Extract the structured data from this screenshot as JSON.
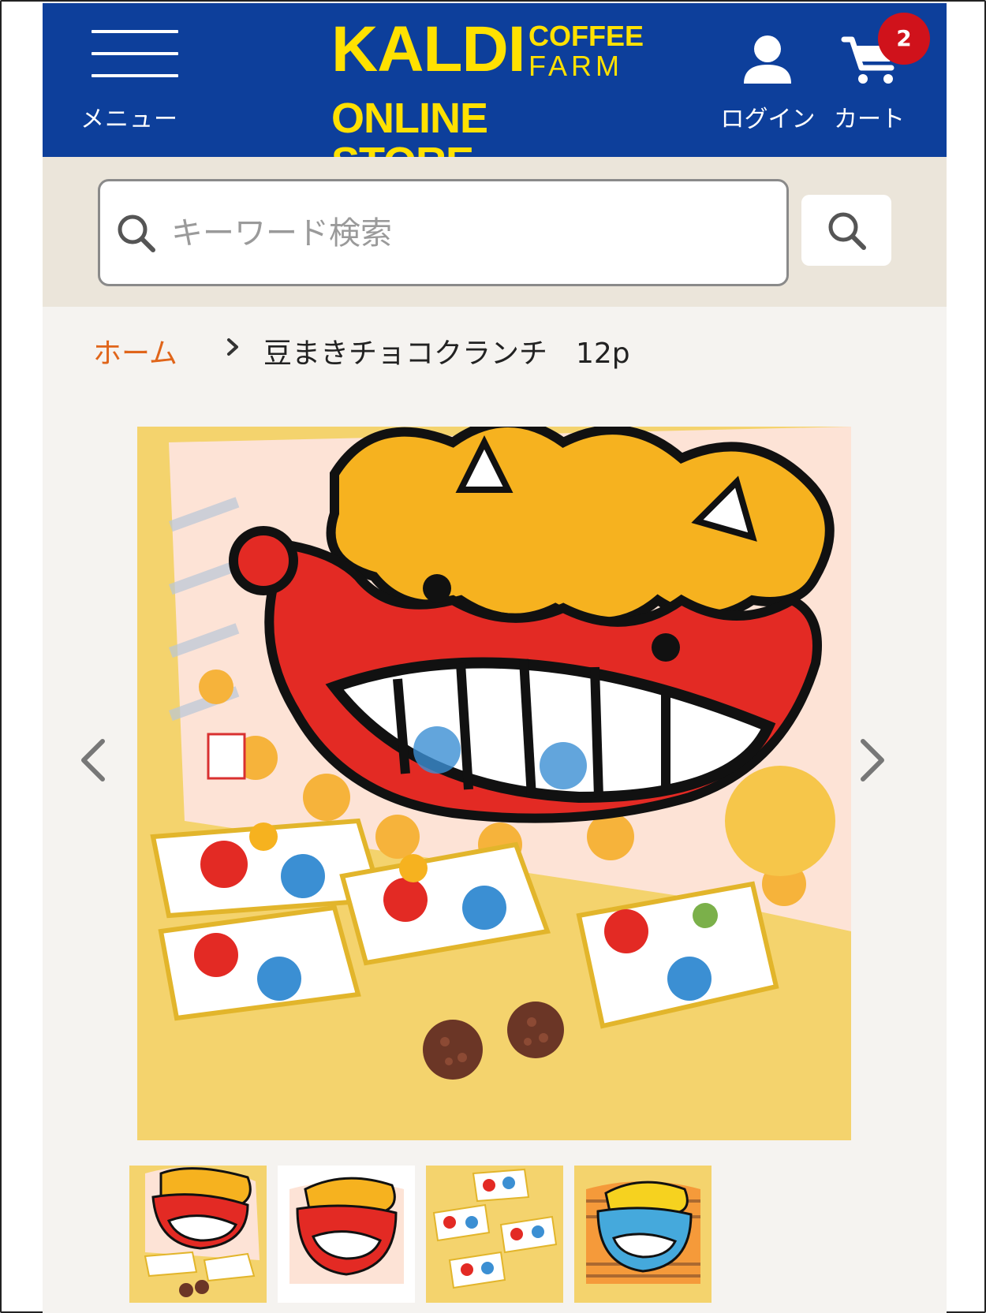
{
  "header": {
    "menu_label": "メニュー",
    "logo": {
      "kaldi": "KALDI",
      "coffee": "COFFEE",
      "farm": "FARM",
      "online_store": "ONLINE STORE"
    },
    "login_label": "ログイン",
    "cart_label": "カート",
    "cart_count": "2"
  },
  "search": {
    "placeholder": "キーワード検索",
    "value": ""
  },
  "breadcrumb": {
    "home": "ホーム",
    "current": "豆まきチョコクランチ　12p"
  },
  "gallery": {
    "main_image": "red-oni-candy-bag-with-wrapped-chocolates",
    "thumbnails": [
      {
        "name": "red-oni-bag-with-candies",
        "selected": true
      },
      {
        "name": "red-oni-bag-front"
      },
      {
        "name": "wrapped-candies-scattered"
      },
      {
        "name": "blue-oni-bag-front"
      }
    ]
  },
  "colors": {
    "header_bg": "#0d3f9b",
    "logo_yellow": "#ffe100",
    "search_band": "#ebe5da",
    "page_bg": "#f5f3f0",
    "breadcrumb_link": "#e0651a",
    "cart_badge": "#d0121b"
  }
}
